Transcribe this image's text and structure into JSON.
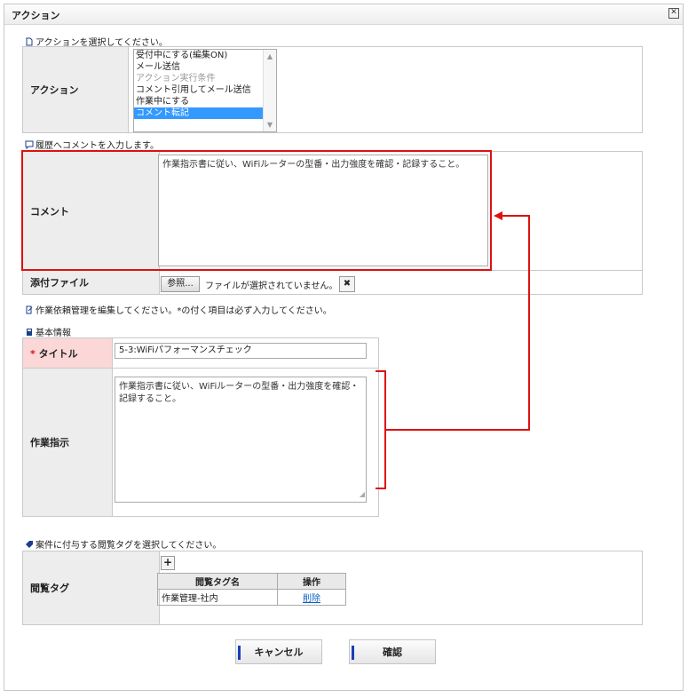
{
  "dialog": {
    "title": "アクション",
    "close_icon": "close-box-icon"
  },
  "action_section": {
    "heading": "アクションを選択してください。",
    "label": "アクション",
    "options": [
      {
        "text": "受付中にする(編集ON)",
        "state": "normal"
      },
      {
        "text": "メール送信",
        "state": "normal"
      },
      {
        "text": "アクション実行条件",
        "state": "disabled"
      },
      {
        "text": "コメント引用してメール送信",
        "state": "normal"
      },
      {
        "text": "作業中にする",
        "state": "normal"
      },
      {
        "text": "コメント転記",
        "state": "selected"
      }
    ]
  },
  "comment_section": {
    "heading": "履歴へコメントを入力します。",
    "comment_label": "コメント",
    "comment_value": "作業指示書に従い、WiFiルーターの型番・出力強度を確認・記録すること。",
    "attach_label": "添付ファイル",
    "browse_label": "参照...",
    "no_file_text": "ファイルが選択されていません。",
    "clear_label": "✖"
  },
  "edit_section": {
    "heading": "作業依頼管理を編集してください。*の付く項目は必ず入力してください。",
    "basic_info": "基本情報",
    "title_star": "*",
    "title_label": "タイトル",
    "title_value": "5-3:WiFiパフォーマンスチェック",
    "instruction_label": "作業指示",
    "instruction_value": "作業指示書に従い、WiFiルーターの型番・出力強度を確認・記録すること。"
  },
  "tag_section": {
    "heading": "案件に付与する閲覧タグを選択してください。",
    "label": "閲覧タグ",
    "add_label": "+",
    "columns": [
      "閲覧タグ名",
      "操作"
    ],
    "rows": [
      {
        "name": "作業管理-社内",
        "action": "削除"
      }
    ]
  },
  "footer": {
    "cancel_label": "キャンセル",
    "confirm_label": "確認"
  },
  "colors": {
    "annotation": "#e01010",
    "selected": "#3399ff",
    "required_bg": "#fbd7d7",
    "link": "#0a63c4"
  }
}
